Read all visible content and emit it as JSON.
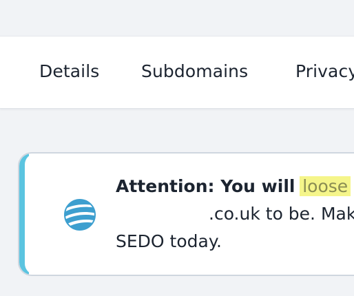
{
  "tabs": [
    {
      "label": "Details"
    },
    {
      "label": "Subdomains"
    },
    {
      "label": "Privacy"
    }
  ],
  "alert": {
    "prefix": "Attention: You will ",
    "highlight": "loose",
    "after_highlight": " £",
    "line2": ".co.uk to be. Mak",
    "line3": "SEDO today.",
    "icon": "globe-icon",
    "accent_color": "#5bc4e0",
    "highlight_color": "#f5f58a"
  }
}
